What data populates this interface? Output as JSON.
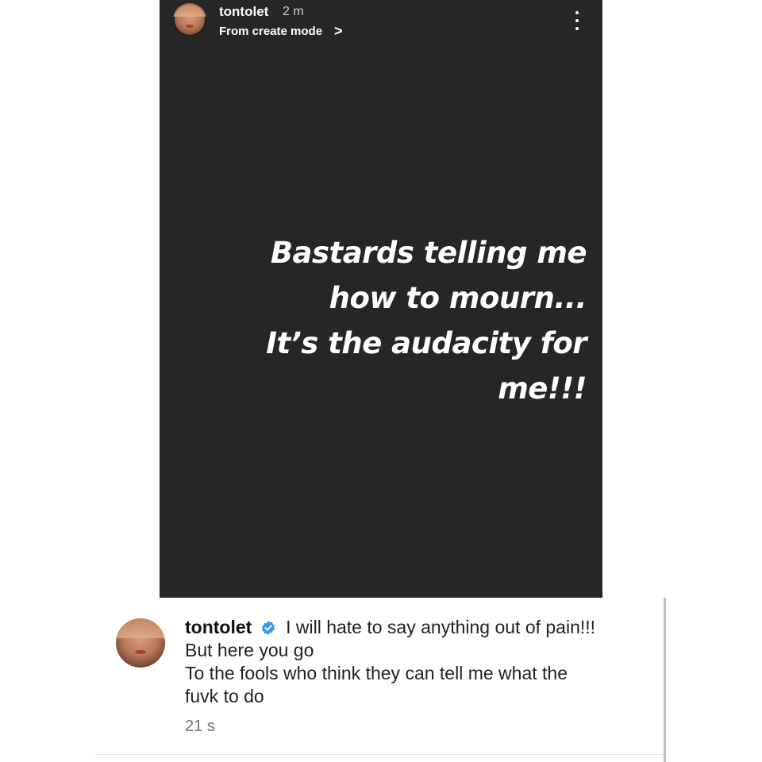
{
  "story": {
    "username": "tontolet",
    "time": "2 m",
    "subtitle": "From create mode",
    "subtitle_chevron": ">",
    "text_lines": [
      "Bastards telling me",
      "how to mourn...",
      "It’s the audacity for",
      "me!!!"
    ],
    "background_color": "#262626"
  },
  "comment": {
    "username": "tontolet",
    "verified": true,
    "lines": [
      "I will hate to say anything out of pain!!!",
      "But here you go",
      "To the fools who think they can tell me what the",
      "fuvk to do"
    ],
    "time": "21 s",
    "accent_color": "#3897f0"
  },
  "icons": {
    "menu": "more-vertical-icon",
    "verified": "verified-badge-icon",
    "chevron": "chevron-right-icon"
  }
}
